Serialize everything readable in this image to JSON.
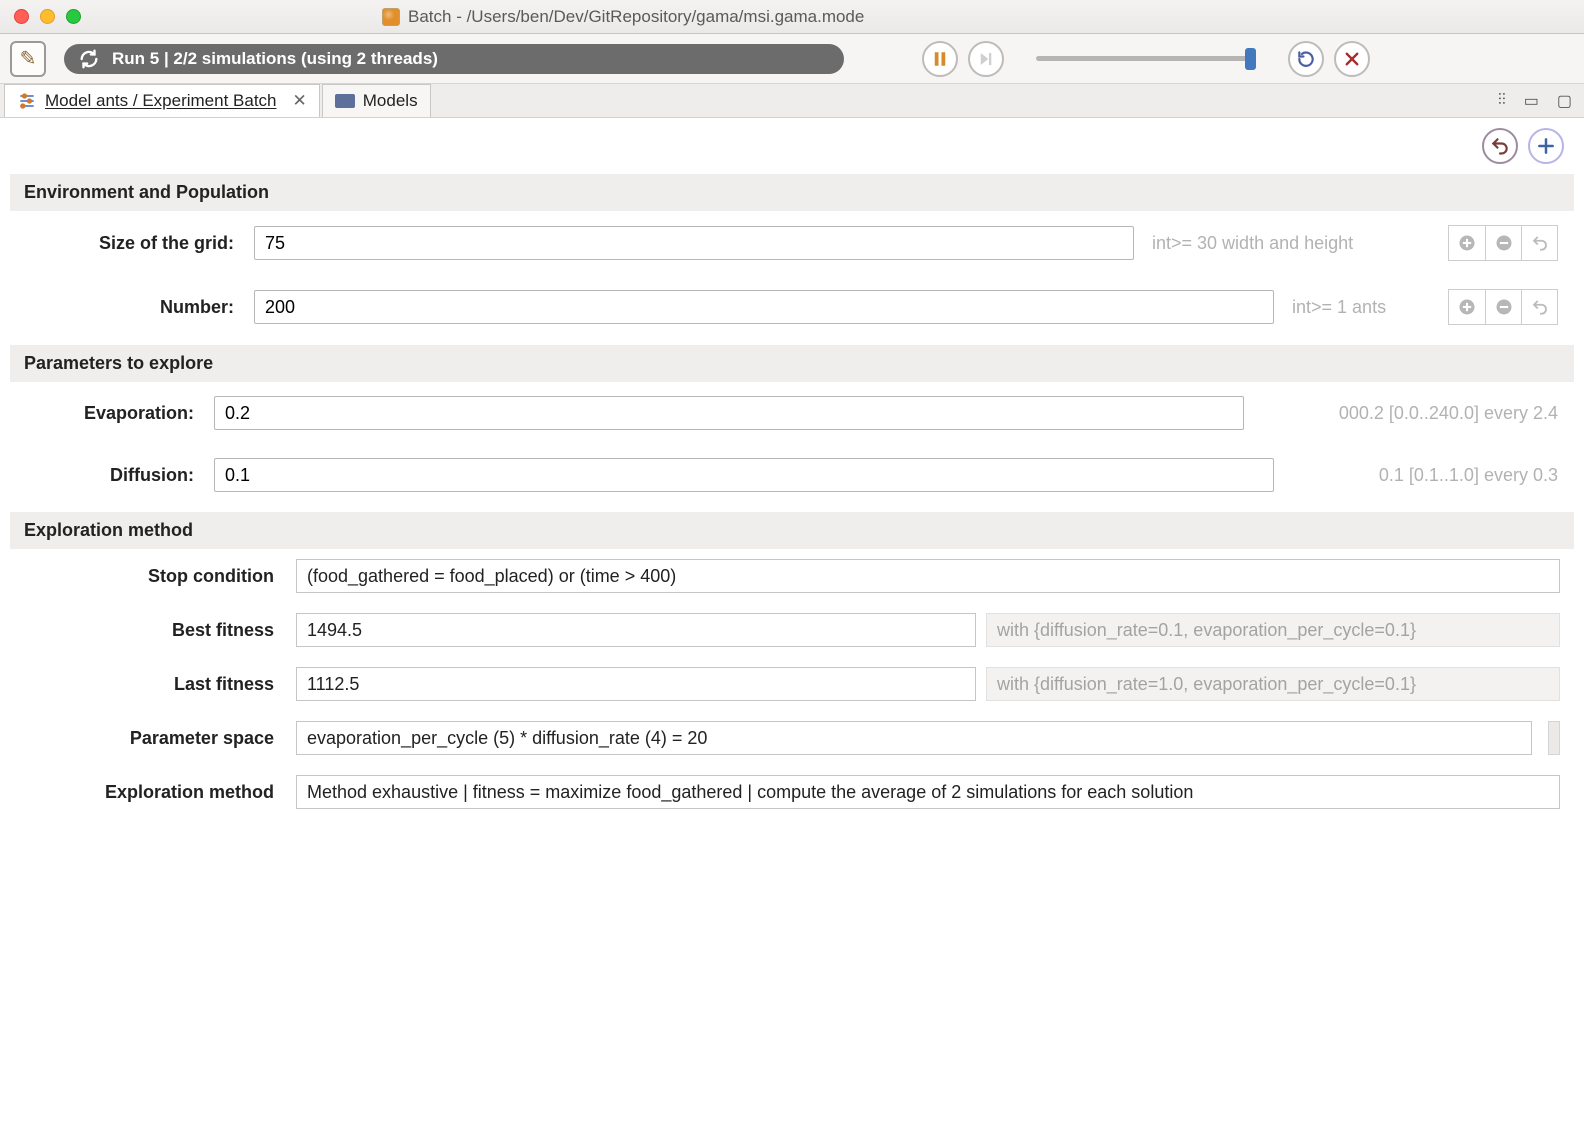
{
  "window": {
    "title": "Batch - /Users/ben/Dev/GitRepository/gama/msi.gama.mode"
  },
  "toolbar": {
    "run_status": "Run 5 | 2/2 simulations (using 2 threads)"
  },
  "tabs": [
    {
      "label": "Model ants / Experiment Batch",
      "active": true
    },
    {
      "label": "Models",
      "active": false
    }
  ],
  "sections": {
    "env_pop": {
      "title": "Environment and Population",
      "rows": [
        {
          "label": "Size of the grid:",
          "value": "75",
          "annot": "int>= 30 width and height"
        },
        {
          "label": "Number:",
          "value": "200",
          "annot": "int>= 1 ants"
        }
      ]
    },
    "explore": {
      "title": "Parameters to explore",
      "rows": [
        {
          "label": "Evaporation:",
          "value": "0.2",
          "annot": "000.2 [0.0..240.0] every 2.4"
        },
        {
          "label": "Diffusion:",
          "value": "0.1",
          "annot": "0.1 [0.1..1.0] every 0.3"
        }
      ]
    },
    "method": {
      "title": "Exploration method",
      "rows": [
        {
          "label": "Stop condition",
          "value": "(food_gathered = food_placed) or (time > 400)"
        },
        {
          "label": "Best fitness",
          "value": "1494.5",
          "annot": "with {diffusion_rate=0.1, evaporation_per_cycle=0.1}"
        },
        {
          "label": "Last fitness",
          "value": "1112.5",
          "annot": "with {diffusion_rate=1.0, evaporation_per_cycle=0.1}"
        },
        {
          "label": "Parameter space",
          "value": "evaporation_per_cycle (5) * diffusion_rate (4)  = 20"
        },
        {
          "label": "Exploration method",
          "value": "Method exhaustive | fitness =  maximize food_gathered | compute the average of 2 simulations for each solution"
        }
      ]
    }
  }
}
